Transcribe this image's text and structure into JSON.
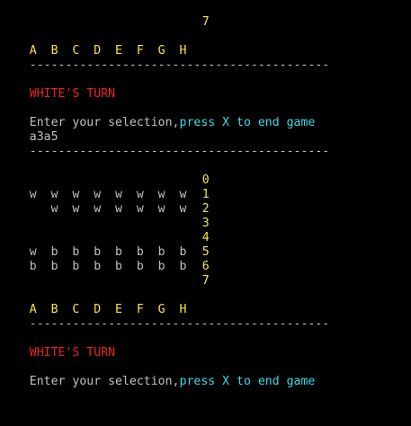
{
  "colors": {
    "background": "#000000",
    "text": "#c0c0c0",
    "yellow": "#f2e64a",
    "red": "#e8261e",
    "cyan": "#3ad9e6"
  },
  "top": {
    "row_number": "7",
    "column_header": "A  B  C  D  E  F  G  H",
    "separator": "------------------------------------------",
    "turn": "WHITE'S TURN",
    "prompt": "Enter your selection,",
    "prompt_hint": "press X to end game",
    "user_input": "a3a5",
    "separator2": "------------------------------------------"
  },
  "board": {
    "rows": [
      {
        "pieces": "",
        "number": "0"
      },
      {
        "pieces": "w  w  w  w  w  w  w  w",
        "number": "1"
      },
      {
        "pieces": "   w  w  w  w  w  w  w",
        "number": "2"
      },
      {
        "pieces": "",
        "number": "3"
      },
      {
        "pieces": "",
        "number": "4"
      },
      {
        "pieces": "w  b  b  b  b  b  b  b",
        "number": "5"
      },
      {
        "pieces": "b  b  b  b  b  b  b  b",
        "number": "6"
      },
      {
        "pieces": "",
        "number": "7"
      }
    ],
    "column_header": "A  B  C  D  E  F  G  H",
    "separator": "------------------------------------------",
    "turn": "WHITE'S TURN",
    "prompt": "Enter your selection,",
    "prompt_hint": "press X to end game"
  }
}
